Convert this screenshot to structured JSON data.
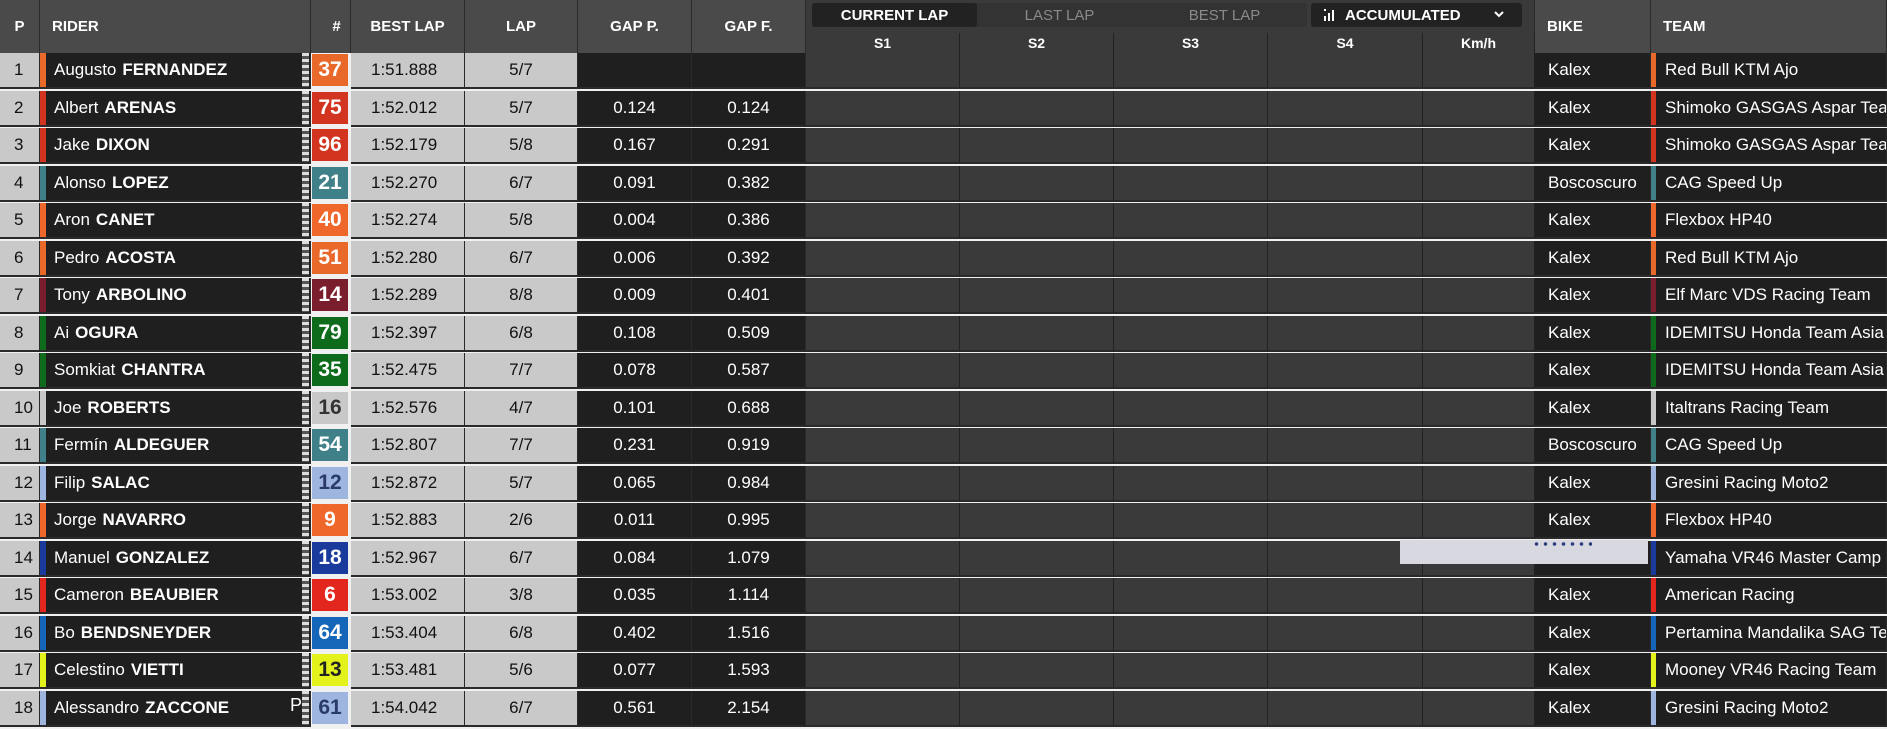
{
  "headers": {
    "pos": "P",
    "rider": "RIDER",
    "num": "#",
    "best_lap": "BEST LAP",
    "lap": "LAP",
    "gap_p": "GAP P.",
    "gap_f": "GAP F.",
    "bike": "BIKE",
    "team": "TEAM"
  },
  "tabs": {
    "current": "CURRENT LAP",
    "last": "LAST LAP",
    "best": "BEST LAP"
  },
  "accumulated": "ACCUMULATED",
  "sector_headers": {
    "s1": "S1",
    "s2": "S2",
    "s3": "S3",
    "s4": "S4",
    "speed": "Km/h"
  },
  "rows": [
    {
      "pos": "1",
      "first": "Augusto",
      "last": "FERNANDEZ",
      "num": "37",
      "best": "1:51.888",
      "lap": "5/7",
      "gap_p": "",
      "gap_f": "",
      "bike": "Kalex",
      "team": "Red Bull KTM Ajo",
      "color": "#e8692a",
      "num_text": "#ffffff",
      "team_color": "#e8692a",
      "flag": ""
    },
    {
      "pos": "2",
      "first": "Albert",
      "last": "ARENAS",
      "num": "75",
      "best": "1:52.012",
      "lap": "5/7",
      "gap_p": "0.124",
      "gap_f": "0.124",
      "bike": "Kalex",
      "team": "Shimoko GASGAS Aspar Team",
      "color": "#d2341f",
      "num_text": "#ffffff",
      "team_color": "#d2341f",
      "flag": ""
    },
    {
      "pos": "3",
      "first": "Jake",
      "last": "DIXON",
      "num": "96",
      "best": "1:52.179",
      "lap": "5/8",
      "gap_p": "0.167",
      "gap_f": "0.291",
      "bike": "Kalex",
      "team": "Shimoko GASGAS Aspar Team",
      "color": "#d2341f",
      "num_text": "#ffffff",
      "team_color": "#d2341f",
      "flag": ""
    },
    {
      "pos": "4",
      "first": "Alonso",
      "last": "LOPEZ",
      "num": "21",
      "best": "1:52.270",
      "lap": "6/7",
      "gap_p": "0.091",
      "gap_f": "0.382",
      "bike": "Boscoscuro",
      "team": "CAG Speed Up",
      "color": "#3f8089",
      "num_text": "#ffffff",
      "team_color": "#3f8089",
      "flag": ""
    },
    {
      "pos": "5",
      "first": "Aron",
      "last": "CANET",
      "num": "40",
      "best": "1:52.274",
      "lap": "5/8",
      "gap_p": "0.004",
      "gap_f": "0.386",
      "bike": "Kalex",
      "team": "Flexbox HP40",
      "color": "#f0672b",
      "num_text": "#ffffff",
      "team_color": "#f0672b",
      "flag": ""
    },
    {
      "pos": "6",
      "first": "Pedro",
      "last": "ACOSTA",
      "num": "51",
      "best": "1:52.280",
      "lap": "6/7",
      "gap_p": "0.006",
      "gap_f": "0.392",
      "bike": "Kalex",
      "team": "Red Bull KTM Ajo",
      "color": "#e8692a",
      "num_text": "#ffffff",
      "team_color": "#e8692a",
      "flag": ""
    },
    {
      "pos": "7",
      "first": "Tony",
      "last": "ARBOLINO",
      "num": "14",
      "best": "1:52.289",
      "lap": "8/8",
      "gap_p": "0.009",
      "gap_f": "0.401",
      "bike": "Kalex",
      "team": "Elf Marc VDS Racing Team",
      "color": "#7a1e2e",
      "num_text": "#ffffff",
      "team_color": "#7a1e2e",
      "flag": ""
    },
    {
      "pos": "8",
      "first": "Ai",
      "last": "OGURA",
      "num": "79",
      "best": "1:52.397",
      "lap": "6/8",
      "gap_p": "0.108",
      "gap_f": "0.509",
      "bike": "Kalex",
      "team": "IDEMITSU Honda Team Asia",
      "color": "#0f6b1c",
      "num_text": "#ffffff",
      "team_color": "#0f6b1c",
      "flag": ""
    },
    {
      "pos": "9",
      "first": "Somkiat",
      "last": "CHANTRA",
      "num": "35",
      "best": "1:52.475",
      "lap": "7/7",
      "gap_p": "0.078",
      "gap_f": "0.587",
      "bike": "Kalex",
      "team": "IDEMITSU Honda Team Asia",
      "color": "#0f6b1c",
      "num_text": "#ffffff",
      "team_color": "#0f6b1c",
      "flag": ""
    },
    {
      "pos": "10",
      "first": "Joe",
      "last": "ROBERTS",
      "num": "16",
      "best": "1:52.576",
      "lap": "4/7",
      "gap_p": "0.101",
      "gap_f": "0.688",
      "bike": "Kalex",
      "team": "Italtrans Racing Team",
      "color": "#c8c8c8",
      "num_text": "#333333",
      "team_color": "#c8c8c8",
      "flag": ""
    },
    {
      "pos": "11",
      "first": "Fermín",
      "last": "ALDEGUER",
      "num": "54",
      "best": "1:52.807",
      "lap": "7/7",
      "gap_p": "0.231",
      "gap_f": "0.919",
      "bike": "Boscoscuro",
      "team": "CAG Speed Up",
      "color": "#3f8089",
      "num_text": "#ffffff",
      "team_color": "#3f8089",
      "flag": ""
    },
    {
      "pos": "12",
      "first": "Filip",
      "last": "SALAC",
      "num": "12",
      "best": "1:52.872",
      "lap": "5/7",
      "gap_p": "0.065",
      "gap_f": "0.984",
      "bike": "Kalex",
      "team": "Gresini Racing Moto2",
      "color": "#9db5df",
      "num_text": "#2a3a6a",
      "team_color": "#9db5df",
      "flag": ""
    },
    {
      "pos": "13",
      "first": "Jorge",
      "last": "NAVARRO",
      "num": "9",
      "best": "1:52.883",
      "lap": "2/6",
      "gap_p": "0.011",
      "gap_f": "0.995",
      "bike": "Kalex",
      "team": "Flexbox HP40",
      "color": "#f0672b",
      "num_text": "#ffffff",
      "team_color": "#f0672b",
      "flag": ""
    },
    {
      "pos": "14",
      "first": "Manuel",
      "last": "GONZALEZ",
      "num": "18",
      "best": "1:52.967",
      "lap": "6/7",
      "gap_p": "0.084",
      "gap_f": "1.079",
      "bike": "Kalex",
      "team": "Yamaha VR46 Master Camp",
      "color": "#1a3a9c",
      "num_text": "#ffffff",
      "team_color": "#1a3a9c",
      "flag": ""
    },
    {
      "pos": "15",
      "first": "Cameron",
      "last": "BEAUBIER",
      "num": "6",
      "best": "1:53.002",
      "lap": "3/8",
      "gap_p": "0.035",
      "gap_f": "1.114",
      "bike": "Kalex",
      "team": "American Racing",
      "color": "#e3261e",
      "num_text": "#ffffff",
      "team_color": "#e3261e",
      "flag": ""
    },
    {
      "pos": "16",
      "first": "Bo",
      "last": "BENDSNEYDER",
      "num": "64",
      "best": "1:53.404",
      "lap": "6/8",
      "gap_p": "0.402",
      "gap_f": "1.516",
      "bike": "Kalex",
      "team": "Pertamina Mandalika SAG Team",
      "color": "#1565b8",
      "num_text": "#ffffff",
      "team_color": "#1565b8",
      "flag": ""
    },
    {
      "pos": "17",
      "first": "Celestino",
      "last": "VIETTI",
      "num": "13",
      "best": "1:53.481",
      "lap": "5/6",
      "gap_p": "0.077",
      "gap_f": "1.593",
      "bike": "Kalex",
      "team": "Mooney VR46 Racing Team",
      "color": "#e3f21b",
      "num_text": "#222222",
      "team_color": "#e3f21b",
      "flag": ""
    },
    {
      "pos": "18",
      "first": "Alessandro",
      "last": "ZACCONE",
      "num": "61",
      "best": "1:54.042",
      "lap": "6/7",
      "gap_p": "0.561",
      "gap_f": "2.154",
      "bike": "Kalex",
      "team": "Gresini Racing Moto2",
      "color": "#9db5df",
      "num_text": "#2a3a6a",
      "team_color": "#9db5df",
      "flag": "P"
    }
  ]
}
